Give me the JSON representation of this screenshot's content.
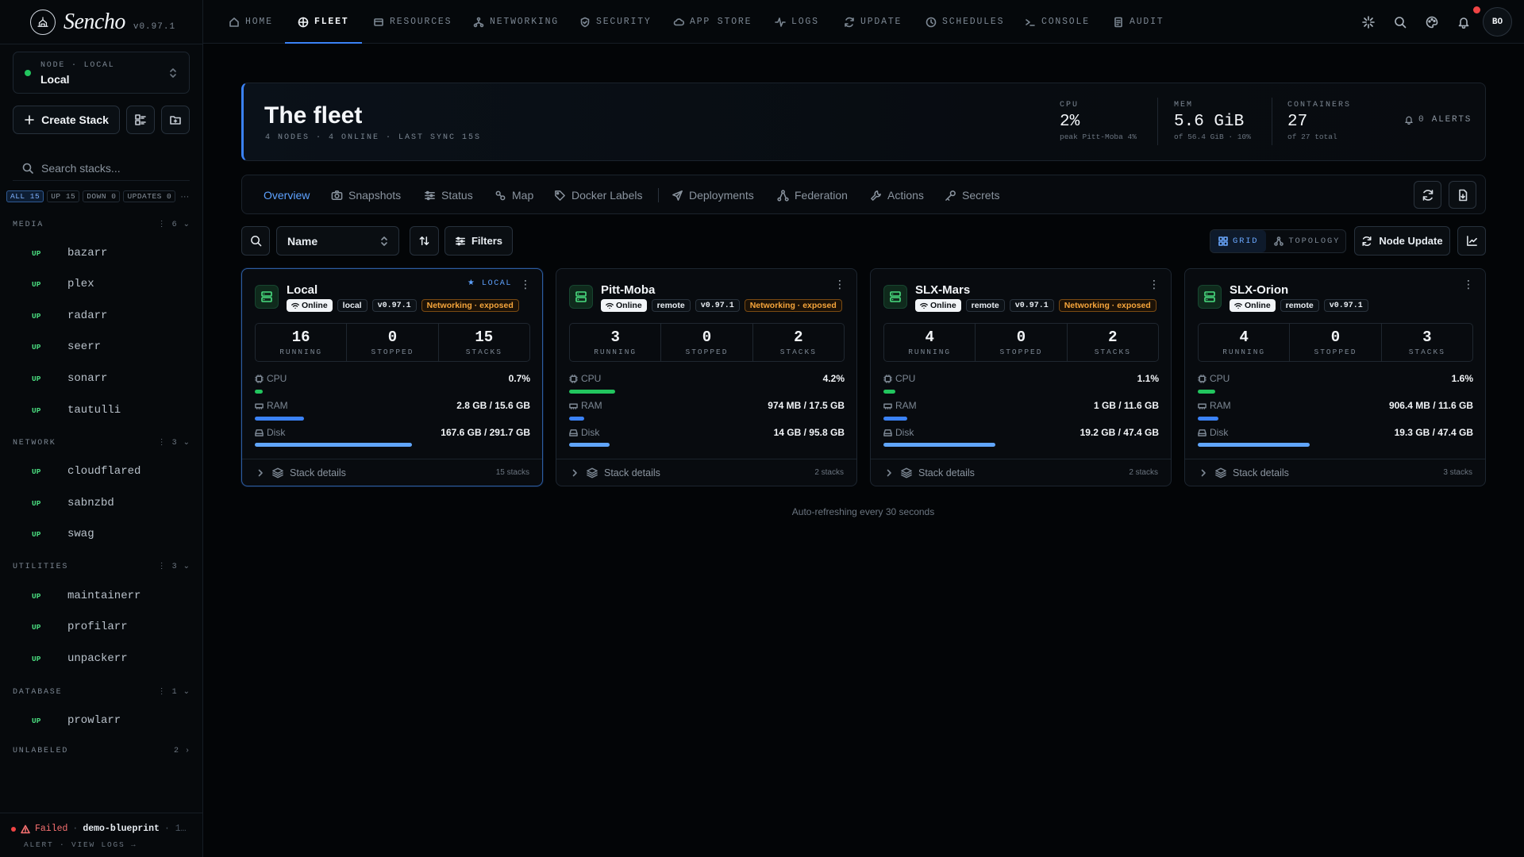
{
  "app": {
    "name": "Sencho",
    "version": "v0.97.1"
  },
  "node_selector": {
    "kicker": "NODE · LOCAL",
    "name": "Local"
  },
  "create_stack_label": "Create Stack",
  "search_placeholder": "Search stacks...",
  "filters": [
    "ALL 15",
    "UP 15",
    "DOWN 0",
    "UPDATES 0"
  ],
  "groups": [
    {
      "name": "MEDIA",
      "count": "6",
      "stacks": [
        {
          "status": "UP",
          "name": "bazarr"
        },
        {
          "status": "UP",
          "name": "plex"
        },
        {
          "status": "UP",
          "name": "radarr"
        },
        {
          "status": "UP",
          "name": "seerr"
        },
        {
          "status": "UP",
          "name": "sonarr"
        },
        {
          "status": "UP",
          "name": "tautulli"
        }
      ]
    },
    {
      "name": "NETWORK",
      "count": "3",
      "stacks": [
        {
          "status": "UP",
          "name": "cloudflared"
        },
        {
          "status": "UP",
          "name": "sabnzbd"
        },
        {
          "status": "UP",
          "name": "swag"
        }
      ]
    },
    {
      "name": "UTILITIES",
      "count": "3",
      "stacks": [
        {
          "status": "UP",
          "name": "maintainerr"
        },
        {
          "status": "UP",
          "name": "profilarr"
        },
        {
          "status": "UP",
          "name": "unpackerr"
        }
      ]
    },
    {
      "name": "DATABASE",
      "count": "1",
      "stacks": [
        {
          "status": "UP",
          "name": "prowlarr"
        }
      ]
    },
    {
      "name": "UNLABELED",
      "count": "2",
      "stacks": []
    }
  ],
  "alert": {
    "status": "Failed",
    "stack": "demo-blueprint",
    "extra": "·  1…",
    "sub": "ALERT · VIEW LOGS →"
  },
  "nav": [
    "HOME",
    "FLEET",
    "RESOURCES",
    "NETWORKING",
    "SECURITY",
    "APP STORE",
    "LOGS",
    "UPDATE",
    "SCHEDULES",
    "CONSOLE",
    "AUDIT"
  ],
  "user_initials": "BO",
  "hero": {
    "title": "The fleet",
    "subtitle": "4 NODES · 4 ONLINE · LAST SYNC 15S",
    "cpu": {
      "label": "CPU",
      "value": "2%",
      "sub": "peak Pitt-Moba 4%"
    },
    "mem": {
      "label": "MEM",
      "value": "5.6 GiB",
      "sub": "of 56.4 GiB · 10%"
    },
    "containers": {
      "label": "CONTAINERS",
      "value": "27",
      "sub": "of 27 total"
    },
    "alerts": "0 ALERTS"
  },
  "subtabs": [
    "Overview",
    "Snapshots",
    "Status",
    "Map",
    "Docker Labels",
    "Deployments",
    "Federation",
    "Actions",
    "Secrets"
  ],
  "toolbar": {
    "sort": "Name",
    "filters": "Filters",
    "grid": "GRID",
    "topology": "TOPOLOGY",
    "node_update": "Node Update"
  },
  "cards": [
    {
      "name": "Local",
      "local_tag": "★ LOCAL",
      "online": "Online",
      "type": "local",
      "version": "v0.97.1",
      "exposure": "Networking · exposed",
      "running": "16",
      "stopped": "0",
      "stacks": "15",
      "running_label": "RUNNING",
      "stopped_label": "STOPPED",
      "stacks_label": "STACKS",
      "cpu_label": "CPU",
      "cpu": "0.7%",
      "cpu_pct": 0.7,
      "ram_label": "RAM",
      "ram": "2.8 GB / 15.6 GB",
      "ram_pct": 18,
      "disk_label": "Disk",
      "disk": "167.6 GB / 291.7 GB",
      "disk_pct": 57,
      "details": "Stack details",
      "stack_count": "15 stacks"
    },
    {
      "name": "Pitt-Moba",
      "local_tag": "",
      "online": "Online",
      "type": "remote",
      "version": "v0.97.1",
      "exposure": "Networking · exposed",
      "running": "3",
      "stopped": "0",
      "stacks": "2",
      "running_label": "RUNNING",
      "stopped_label": "STOPPED",
      "stacks_label": "STACKS",
      "cpu_label": "CPU",
      "cpu": "4.2%",
      "cpu_pct": 4.2,
      "ram_label": "RAM",
      "ram": "974 MB / 17.5 GB",
      "ram_pct": 5.6,
      "disk_label": "Disk",
      "disk": "14 GB / 95.8 GB",
      "disk_pct": 14.6,
      "details": "Stack details",
      "stack_count": "2 stacks"
    },
    {
      "name": "SLX-Mars",
      "local_tag": "",
      "online": "Online",
      "type": "remote",
      "version": "v0.97.1",
      "exposure": "Networking · exposed",
      "running": "4",
      "stopped": "0",
      "stacks": "2",
      "running_label": "RUNNING",
      "stopped_label": "STOPPED",
      "stacks_label": "STACKS",
      "cpu_label": "CPU",
      "cpu": "1.1%",
      "cpu_pct": 1.1,
      "ram_label": "RAM",
      "ram": "1 GB / 11.6 GB",
      "ram_pct": 8.6,
      "disk_label": "Disk",
      "disk": "19.2 GB / 47.4 GB",
      "disk_pct": 40.5,
      "details": "Stack details",
      "stack_count": "2 stacks"
    },
    {
      "name": "SLX-Orion",
      "local_tag": "",
      "online": "Online",
      "type": "remote",
      "version": "v0.97.1",
      "exposure": "",
      "running": "4",
      "stopped": "0",
      "stacks": "3",
      "running_label": "RUNNING",
      "stopped_label": "STOPPED",
      "stacks_label": "STACKS",
      "cpu_label": "CPU",
      "cpu": "1.6%",
      "cpu_pct": 1.6,
      "ram_label": "RAM",
      "ram": "906.4 MB / 11.6 GB",
      "ram_pct": 7.6,
      "disk_label": "Disk",
      "disk": "19.3 GB / 47.4 GB",
      "disk_pct": 40.7,
      "details": "Stack details",
      "stack_count": "3 stacks"
    }
  ],
  "auto_refresh": "Auto-refreshing every 30 seconds",
  "colors": {
    "accent": "#3b82f6",
    "online": "#22c55e",
    "ram_bar": "#3b82f6",
    "disk_bar": "#60a5fa",
    "warn": "#f6a53b",
    "alert": "#ef4444"
  }
}
